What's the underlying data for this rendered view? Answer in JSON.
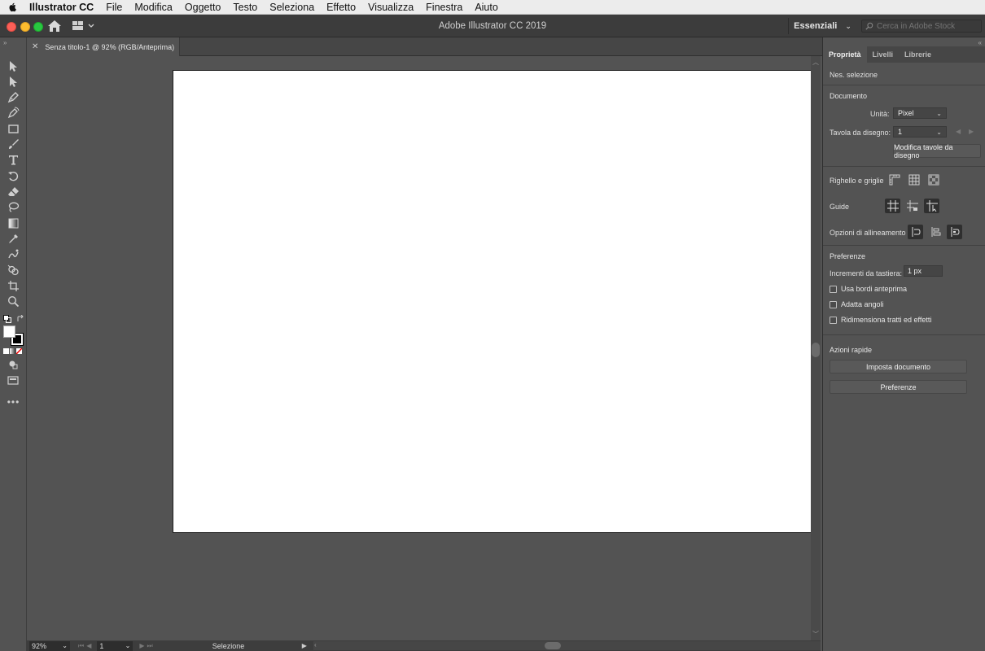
{
  "menubar": {
    "app_name": "Illustrator CC",
    "items": [
      "File",
      "Modifica",
      "Oggetto",
      "Testo",
      "Seleziona",
      "Effetto",
      "Visualizza",
      "Finestra",
      "Aiuto"
    ]
  },
  "titlebar": {
    "title": "Adobe Illustrator CC 2019",
    "workspace": "Essenziali",
    "search_placeholder": "Cerca in Adobe Stock"
  },
  "document": {
    "tab_label": "Senza titolo-1 @ 92% (RGB/Anteprima)"
  },
  "tools": [
    {
      "name": "selection-tool",
      "icon": "arrow-icon"
    },
    {
      "name": "direct-selection-tool",
      "icon": "white-arrow-icon"
    },
    {
      "name": "pen-tool",
      "icon": "pen-icon"
    },
    {
      "name": "curvature-tool",
      "icon": "curvature-icon"
    },
    {
      "name": "rectangle-tool",
      "icon": "rectangle-icon"
    },
    {
      "name": "paintbrush-tool",
      "icon": "brush-icon"
    },
    {
      "name": "type-tool",
      "icon": "type-icon"
    },
    {
      "name": "rotate-tool",
      "icon": "rotate-icon"
    },
    {
      "name": "eraser-tool",
      "icon": "eraser-icon"
    },
    {
      "name": "lasso-tool",
      "icon": "lasso-icon"
    },
    {
      "name": "gradient-tool",
      "icon": "gradient-icon"
    },
    {
      "name": "eyedropper-tool",
      "icon": "eyedropper-icon"
    },
    {
      "name": "puppet-warp-tool",
      "icon": "puppet-icon"
    },
    {
      "name": "shape-builder-tool",
      "icon": "shape-builder-icon"
    },
    {
      "name": "artboard-tool",
      "icon": "artboard-icon"
    },
    {
      "name": "zoom-tool",
      "icon": "zoom-icon"
    }
  ],
  "statusbar": {
    "zoom": "92%",
    "artboard_number": "1",
    "mode": "Selezione"
  },
  "panel": {
    "tabs": [
      "Proprietà",
      "Livelli",
      "Librerie"
    ],
    "active_tab": "Proprietà",
    "no_selection": "Nes. selezione",
    "document_title": "Documento",
    "units_label": "Unità:",
    "units_value": "Pixel",
    "artboard_label": "Tavola da disegno:",
    "artboard_value": "1",
    "edit_artboards_button": "Modifica tavole da disegno",
    "rulers_grids_label": "Righello e griglie",
    "guides_label": "Guide",
    "align_options_label": "Opzioni di allineamento",
    "preferences_title": "Preferenze",
    "keyboard_increment_label": "Incrementi da tastiera:",
    "keyboard_increment_value": "1 px",
    "checkboxes": [
      "Usa bordi anteprima",
      "Adatta angoli",
      "Ridimensiona tratti ed effetti"
    ],
    "quick_actions_title": "Azioni rapide",
    "document_setup_button": "Imposta documento",
    "preferences_button": "Preferenze"
  }
}
